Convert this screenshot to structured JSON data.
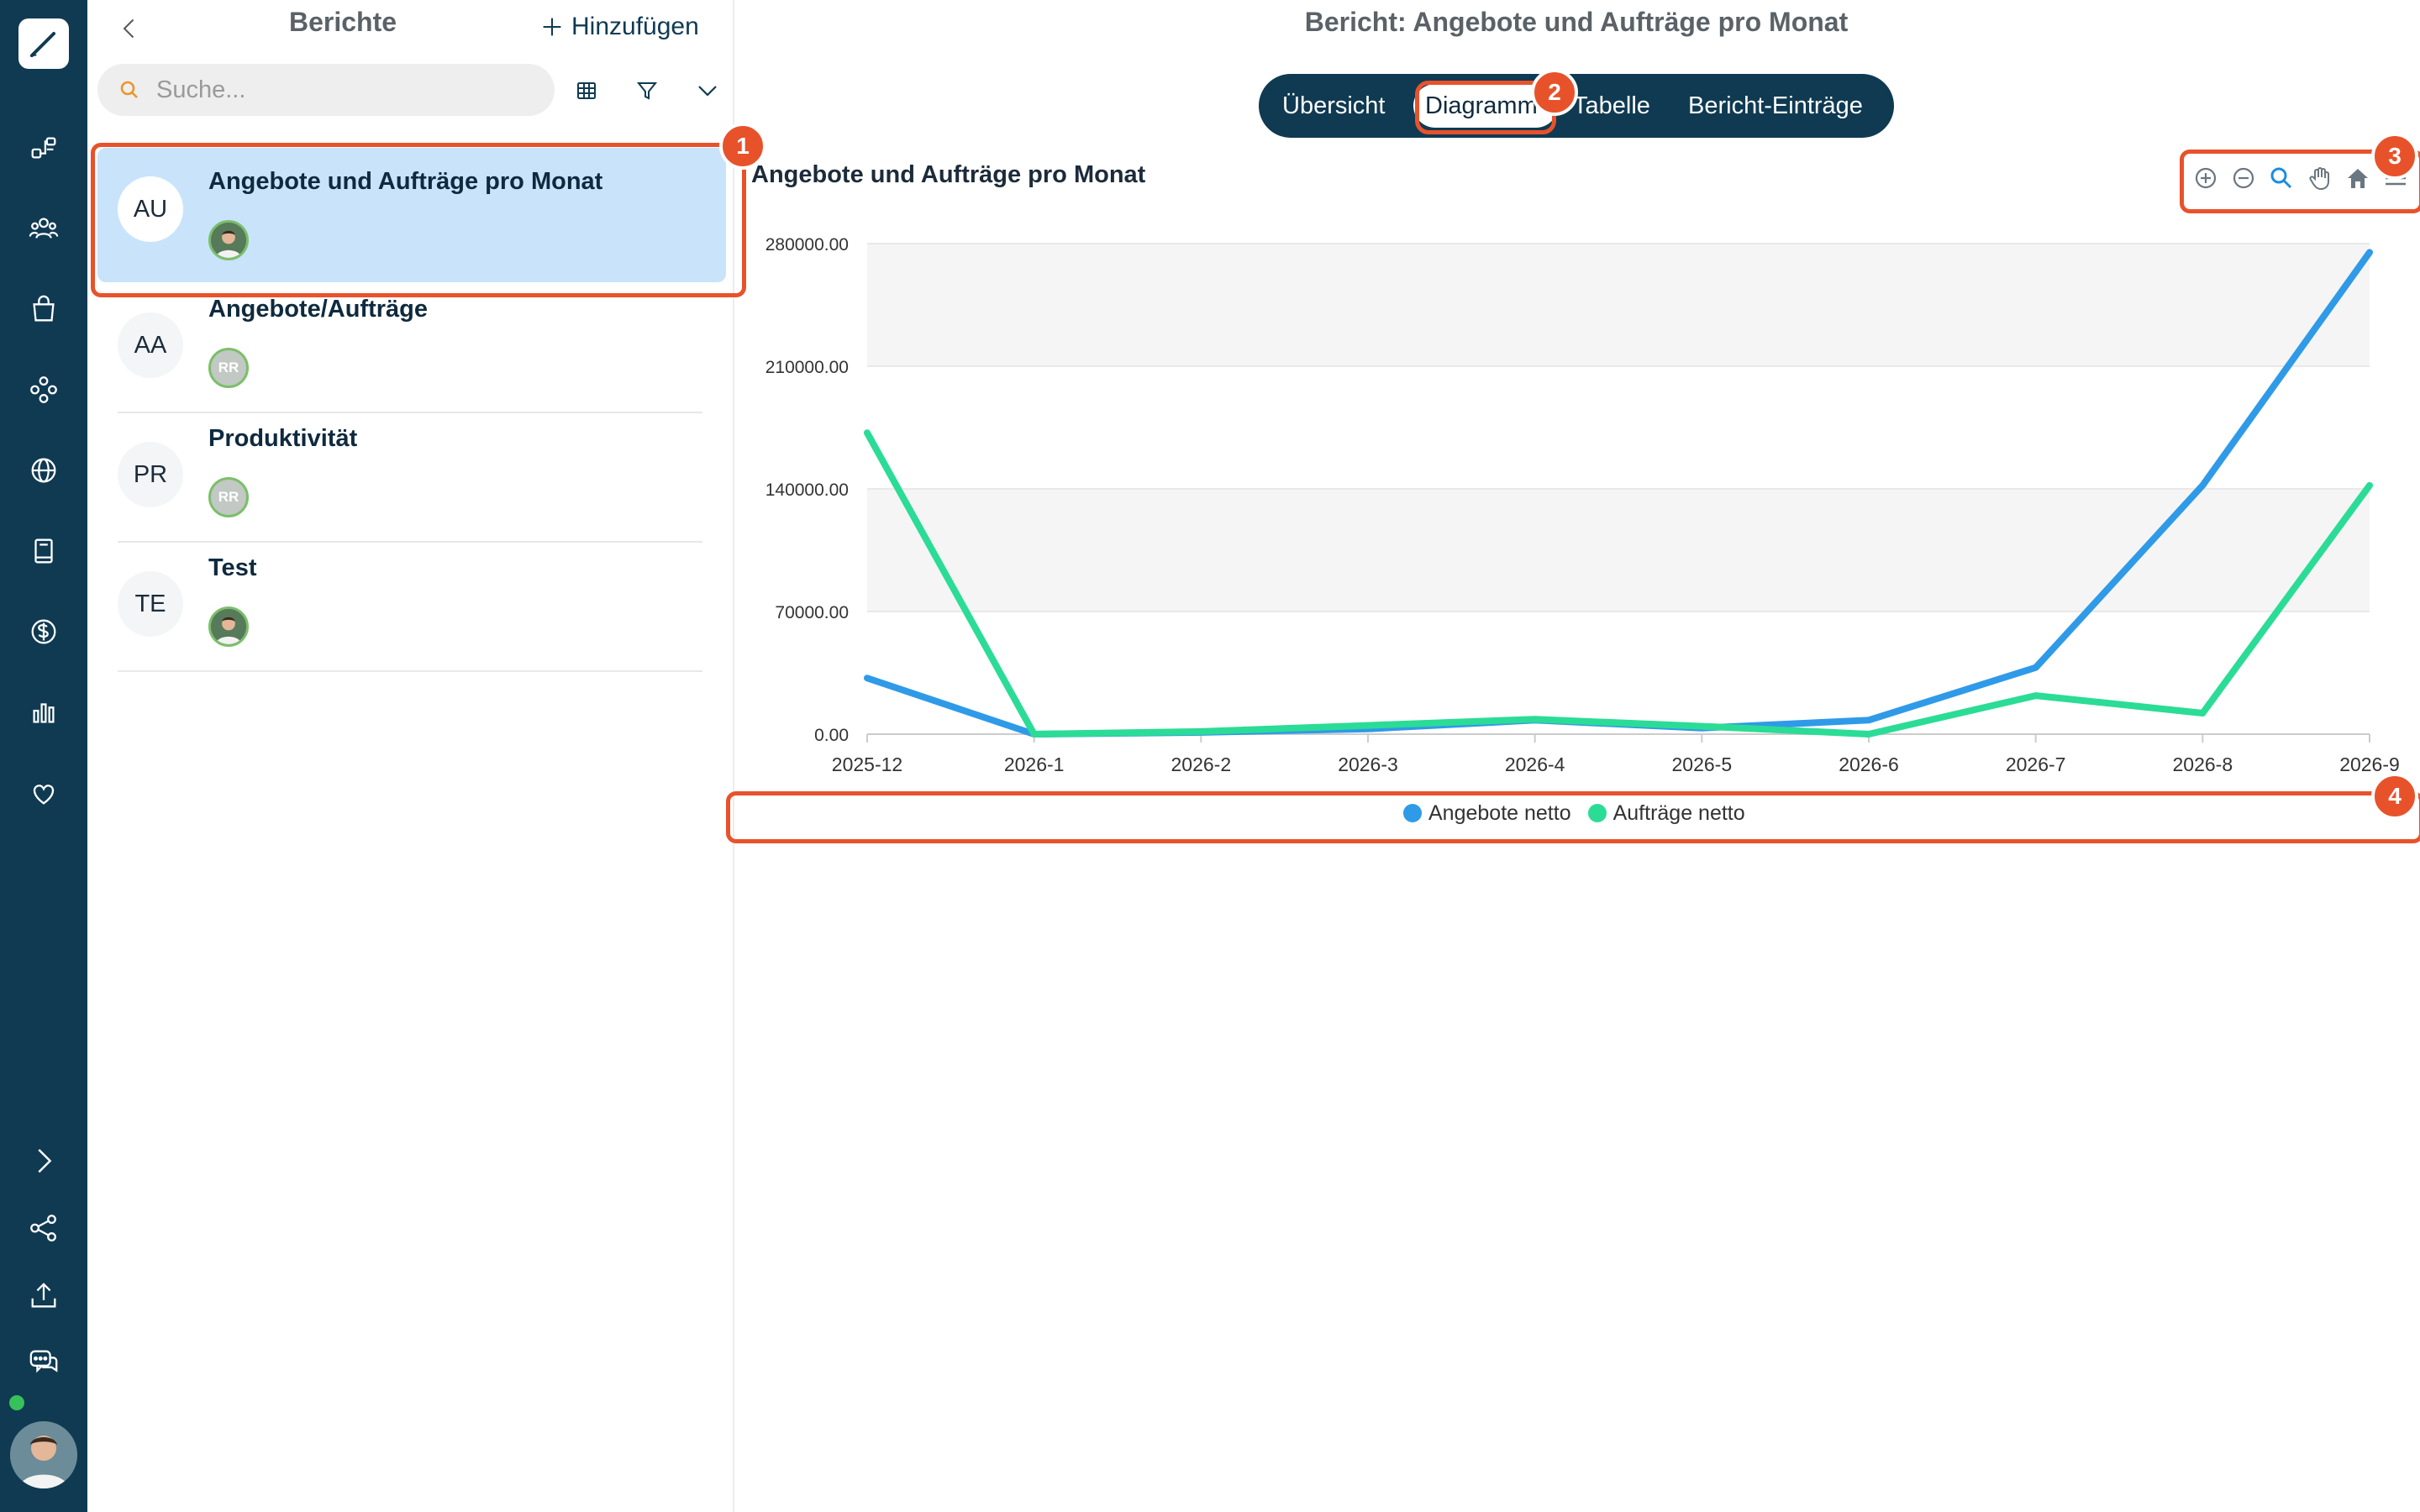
{
  "list_panel": {
    "title": "Berichte",
    "add_label": "Hinzufügen",
    "search_placeholder": "Suche...",
    "reports": [
      {
        "initials": "AU",
        "name": "Angebote und Aufträge pro Monat",
        "owner": "photo",
        "selected": true
      },
      {
        "initials": "AA",
        "name": "Angebote/Aufträge",
        "owner_initials": "RR"
      },
      {
        "initials": "PR",
        "name": "Produktivität",
        "owner_initials": "RR"
      },
      {
        "initials": "TE",
        "name": "Test",
        "owner": "photo"
      }
    ]
  },
  "main": {
    "title": "Bericht: Angebote und Aufträge pro Monat",
    "tabs": [
      "Übersicht",
      "Diagramm",
      "Tabelle",
      "Bericht-Einträge"
    ],
    "active_tab": "Diagramm"
  },
  "callouts": [
    "1",
    "2",
    "3",
    "4"
  ],
  "colors": {
    "rail": "#0f3a52",
    "accent": "#e8522b",
    "series_angebote": "#2f9ae8",
    "series_auftraege": "#2bdc96"
  },
  "icons": [
    "pen-icon",
    "flow-icon",
    "users-icon",
    "bag-icon",
    "cluster-icon",
    "globe-icon",
    "book-icon",
    "dollar-icon",
    "bar-chart-icon",
    "heart-icon",
    "chevron-right-icon",
    "share-icon",
    "upload-icon",
    "chat-icon"
  ],
  "chart_data": {
    "type": "line",
    "title": "Angebote und Aufträge pro Monat",
    "xlabel": "",
    "ylabel": "",
    "categories": [
      "2025-12",
      "2026-1",
      "2026-2",
      "2026-3",
      "2026-4",
      "2026-5",
      "2026-6",
      "2026-7",
      "2026-8",
      "2026-9"
    ],
    "yticks": [
      "0.00",
      "70000.00",
      "140000.00",
      "210000.00",
      "280000.00"
    ],
    "ylim": [
      0,
      280000
    ],
    "series": [
      {
        "name": "Angebote netto",
        "color": "#2f9ae8",
        "values": [
          32000,
          0,
          1000,
          3000,
          8000,
          3500,
          8000,
          38000,
          142000,
          275000
        ]
      },
      {
        "name": "Aufträge netto",
        "color": "#2bdc96",
        "values": [
          172000,
          0,
          1500,
          5000,
          8500,
          4500,
          0,
          22000,
          12000,
          142000
        ]
      }
    ],
    "grid": true,
    "legend": "bottom-center"
  }
}
